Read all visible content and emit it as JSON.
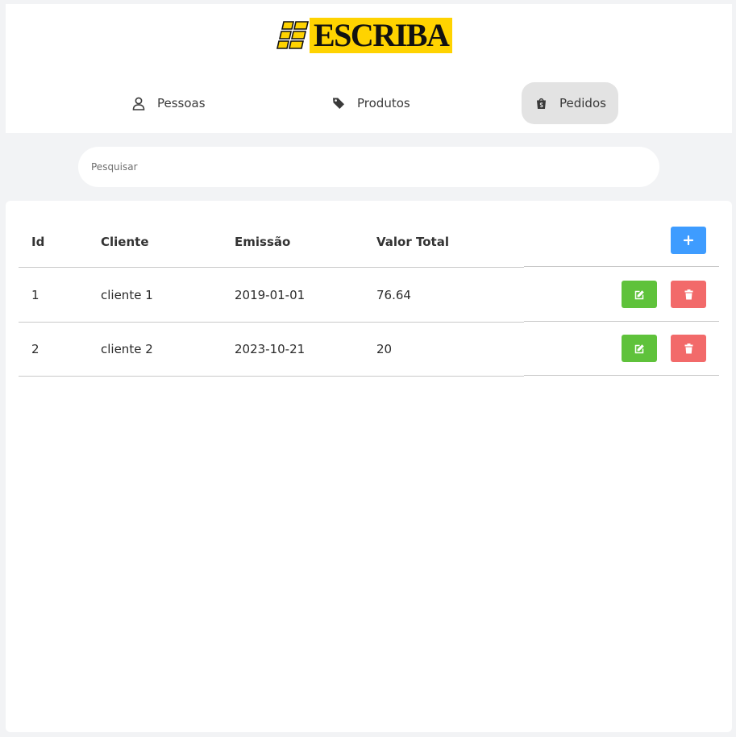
{
  "brand": {
    "name": "ESCRIBA",
    "color": "#ffd300"
  },
  "nav": {
    "items": [
      {
        "label": "Pessoas",
        "icon": "user-icon"
      },
      {
        "label": "Produtos",
        "icon": "tag-icon"
      },
      {
        "label": "Pedidos",
        "icon": "shopping-bag-icon",
        "active": true
      }
    ]
  },
  "search": {
    "placeholder": "Pesquisar",
    "value": ""
  },
  "table": {
    "headers": [
      "Id",
      "Cliente",
      "Emissão",
      "Valor Total"
    ],
    "rows": [
      {
        "id": "1",
        "cliente": "cliente 1",
        "emissao": "2019-01-01",
        "valor": "76.64"
      },
      {
        "id": "2",
        "cliente": "cliente 2",
        "emissao": "2023-10-21",
        "valor": "20"
      }
    ],
    "actions": {
      "add_icon": "plus-icon",
      "edit_icon": "edit-icon",
      "delete_icon": "trash-icon"
    }
  },
  "colors": {
    "add": "#3e9cff",
    "edit": "#5fc23b",
    "delete": "#f26a6a",
    "active_nav": "#e3e3e3"
  }
}
